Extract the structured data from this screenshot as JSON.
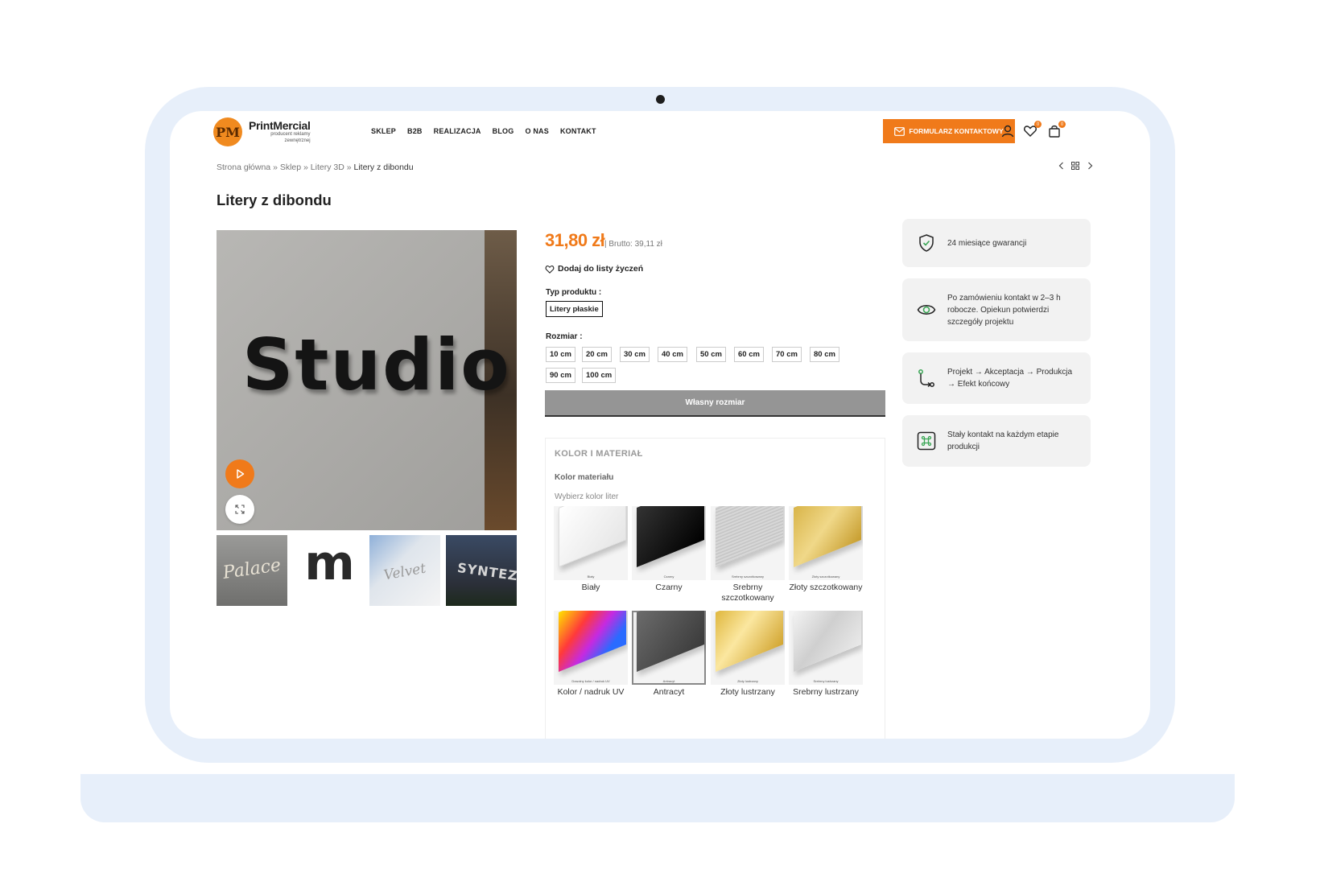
{
  "header": {
    "logo_name": "PrintMercial",
    "logo_mark": "PM",
    "logo_tag_line1": "producent reklamy",
    "logo_tag_line2": "zewnętrznej",
    "nav": [
      "SKLEP",
      "B2B",
      "REALIZACJA",
      "BLOG",
      "O NAS",
      "KONTAKT"
    ],
    "cta_label": "FORMULARZ KONTAKTOWY",
    "wishlist_count": "0",
    "cart_count": "0"
  },
  "breadcrumb": {
    "items": [
      "Strona główna",
      "Sklep",
      "Litery 3D"
    ],
    "separator": "»",
    "current": "Litery z dibondu"
  },
  "product": {
    "title": "Litery z dibondu",
    "price": "31,80 zł",
    "brutto": "| Brutto: 39,11 zł",
    "wishlist_label": "Dodaj do listy życzeń",
    "main_image_text": "Studio",
    "thumbnails": [
      "Palace",
      "m",
      "Velvet",
      "SYNTEZA"
    ],
    "type_label": "Typ produktu",
    "colon": ":",
    "types": [
      "Litery płaskie"
    ],
    "size_label": "Rozmiar",
    "sizes": [
      "10 cm",
      "20 cm",
      "30 cm",
      "40 cm",
      "50 cm",
      "60 cm",
      "70 cm",
      "80 cm",
      "90 cm",
      "100 cm"
    ],
    "custom_size_label": "Własny rozmiar"
  },
  "colors": {
    "section_title": "KOLOR I MATERIAŁ",
    "subtitle": "Kolor materiału",
    "hint": "Wybierz kolor liter",
    "swatches": [
      {
        "name": "Biały",
        "mini": "Biały"
      },
      {
        "name": "Czarny",
        "mini": "Czarny"
      },
      {
        "name": "Srebrny szczotkowany",
        "mini": "Srebrny szczotkowany"
      },
      {
        "name": "Złoty szczotkowany",
        "mini": "Złoty szczotkowany"
      },
      {
        "name": "Kolor / nadruk UV",
        "mini": "Dowolny kolor / nadruk UV"
      },
      {
        "name": "Antracyt",
        "mini": "Antracyt"
      },
      {
        "name": "Złoty lustrzany",
        "mini": "Złoty lustrzany"
      },
      {
        "name": "Srebrny lustrzany",
        "mini": "Srebrny lustrzany"
      }
    ],
    "selected": "Antracyt"
  },
  "benefits": [
    {
      "icon": "shield-check-icon",
      "text": "24 miesiące gwarancji"
    },
    {
      "icon": "eye-icon",
      "text": "Po zamówieniu kontakt w 2–3 h robocze. Opiekun potwierdzi szczegóły projektu"
    },
    {
      "icon": "workflow-icon",
      "text": "Projekt → Akceptacja → Produkcja → Efekt końcowy"
    },
    {
      "icon": "command-icon",
      "text": "Stały kontakt na każdym etapie produkcji"
    }
  ],
  "colors_theme": {
    "accent": "#f07a1a",
    "frame": "#e7effa",
    "benefit_bg": "#f2f2f2"
  }
}
